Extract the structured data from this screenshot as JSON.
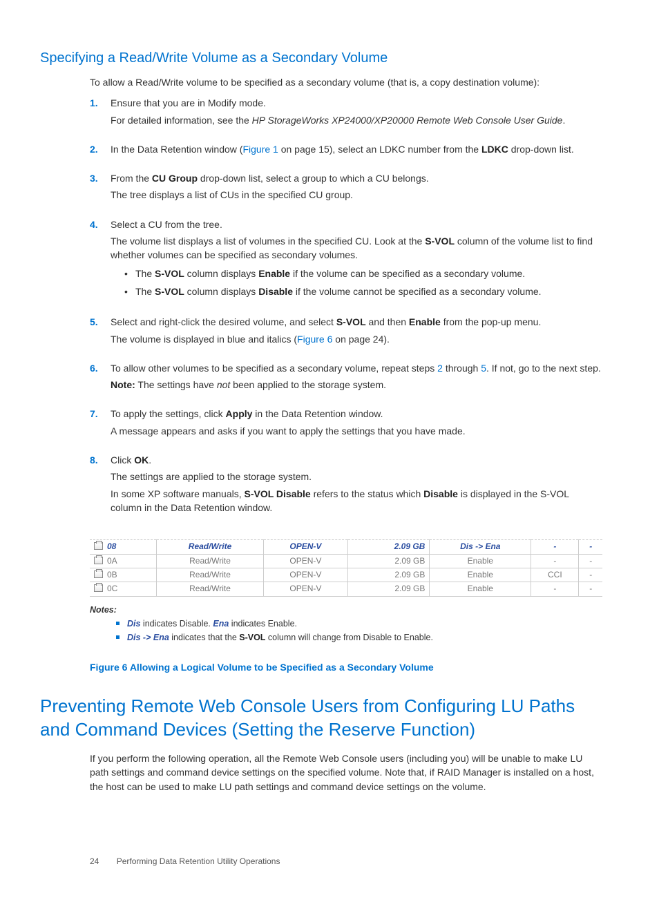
{
  "heading1": "Specifying a Read/Write Volume as a Secondary Volume",
  "intro": "To allow a Read/Write volume to be specified as a secondary volume (that is, a copy destination volume):",
  "steps": {
    "s1": {
      "num": "1.",
      "p1a": "Ensure that you are in Modify mode.",
      "p1b_pre": "For detailed information, see the ",
      "p1b_ital": "HP StorageWorks XP24000/XP20000 Remote Web Console User Guide",
      "p1b_post": "."
    },
    "s2": {
      "num": "2.",
      "p_pre": "In the Data Retention window (",
      "link": "Figure 1",
      "p_mid": " on page 15), select an LDKC number from the ",
      "bold": "LDKC",
      "p_post": " drop-down list."
    },
    "s3": {
      "num": "3.",
      "p1_pre": "From the ",
      "p1_bold": "CU Group",
      "p1_post": " drop-down list, select a group to which a CU belongs.",
      "p2": "The tree displays a list of CUs in the specified CU group."
    },
    "s4": {
      "num": "4.",
      "p1": "Select a CU from the tree.",
      "p2_pre": "The volume list displays a list of volumes in the specified CU. Look at the ",
      "p2_bold": "S-VOL",
      "p2_post": " column of the volume list to find whether volumes can be specified as secondary volumes.",
      "b1_pre": "The ",
      "b1_b1": "S-VOL",
      "b1_mid": " column displays ",
      "b1_b2": "Enable",
      "b1_post": " if the volume can be specified as a secondary volume.",
      "b2_pre": "The ",
      "b2_b1": "S-VOL",
      "b2_mid": " column displays ",
      "b2_b2": "Disable",
      "b2_post": " if the volume cannot be specified as a secondary volume."
    },
    "s5": {
      "num": "5.",
      "p1_pre": "Select and right-click the desired volume, and select ",
      "p1_b1": "S-VOL",
      "p1_mid": " and then ",
      "p1_b2": "Enable",
      "p1_post": " from the pop-up menu.",
      "p2_pre": "The volume is displayed in blue and italics (",
      "p2_link": "Figure 6",
      "p2_post": " on page 24)."
    },
    "s6": {
      "num": "6.",
      "p1_pre": "To allow other volumes to be specified as a secondary volume, repeat steps ",
      "p1_l1": "2",
      "p1_mid": " through ",
      "p1_l2": "5",
      "p1_post": ". If not, go to the next step.",
      "p2_bold": "Note:",
      "p2_mid": " The settings have ",
      "p2_ital": "not",
      "p2_post": " been applied to the storage system."
    },
    "s7": {
      "num": "7.",
      "p1_pre": "To apply the settings, click ",
      "p1_bold": "Apply",
      "p1_post": " in the Data Retention window.",
      "p2": "A message appears and asks if you want to apply the settings that you have made."
    },
    "s8": {
      "num": "8.",
      "p1_pre": "Click ",
      "p1_bold": "OK",
      "p1_post": ".",
      "p2": "The settings are applied to the storage system.",
      "p3_pre": "In some XP software manuals, ",
      "p3_b1": "S-VOL Disable",
      "p3_mid": " refers to the status which ",
      "p3_b2": "Disable",
      "p3_post": " is displayed in the S-VOL column in the Data Retention window."
    }
  },
  "table": {
    "rows": [
      {
        "id": "08",
        "attr": "Read/Write",
        "emu": "OPEN-V",
        "cap": "2.09 GB",
        "svol": "Dis -> Ena",
        "rsv": "-",
        "last": "-",
        "hl": true
      },
      {
        "id": "0A",
        "attr": "Read/Write",
        "emu": "OPEN-V",
        "cap": "2.09 GB",
        "svol": "Enable",
        "rsv": "-",
        "last": "-",
        "hl": false
      },
      {
        "id": "0B",
        "attr": "Read/Write",
        "emu": "OPEN-V",
        "cap": "2.09 GB",
        "svol": "Enable",
        "rsv": "CCI",
        "last": "-",
        "hl": false
      },
      {
        "id": "0C",
        "attr": "Read/Write",
        "emu": "OPEN-V",
        "cap": "2.09 GB",
        "svol": "Enable",
        "rsv": "-",
        "last": "-",
        "hl": false
      }
    ]
  },
  "notes": {
    "title": "Notes:",
    "n1": {
      "k1": "Dis",
      "t1": " indicates Disable. ",
      "k2": "Ena",
      "t2": " indicates Enable."
    },
    "n2": {
      "k1": "Dis -> Ena",
      "t1": " indicates that the ",
      "b1": "S-VOL",
      "t2": " column will change from Disable to Enable."
    }
  },
  "figcaption": "Figure 6 Allowing a Logical Volume to be Specified as a Secondary Volume",
  "heading2": "Preventing Remote Web Console Users from Configuring LU Paths and Command Devices (Setting the Reserve Function)",
  "para2": "If you perform the following operation, all the Remote Web Console users (including you) will be unable to make LU path settings and command device settings on the specified volume. Note that, if RAID Manager is installed on a host, the host can be used to make LU path settings and command device settings on the volume.",
  "footer": {
    "page": "24",
    "chapter": "Performing Data Retention Utility Operations"
  }
}
